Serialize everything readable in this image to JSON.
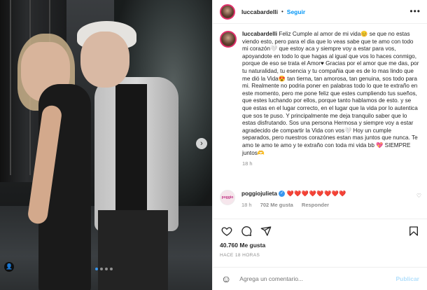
{
  "post": {
    "username": "luccabardelli",
    "separator": "•",
    "follow_label": "Seguir",
    "more_label": "•••",
    "caption_text": "Feliz Cumple al amor de mi vida😊 se que no estas viendo esto, pero para el dia que lo veas sabe que te amo con todo mi corazón🤍 que estoy aca y siempre voy a estar para vos, apoyandote en todo lo que hagas al igual que vos lo haces conmigo, porque de eso se trata el Amor♥ Gracias por el amor que me das, por tu naturalidad, tu esencia y tu compañia que es de lo mas lindo que me dió la Vida😍 tan tierna, tan amorosa, tan genuina, sos todo para mi. Realmente no podria poner en palabras todo lo que te extraño en este momento, pero me pone feliz que estes cumpliendo tus sueños, que estes luchando por ellos, porque tanto hablamos de esto. y se que estas en el lugar correcto, en el lugar que la vida por lo autentica que sos te puso. Y principalmente me deja tranquilo saber que lo estas disfrutando. Sos una persona Hermosa y siempre voy a estar agradecido de compartir la Vida con vos🤍 Hoy un cumple separados, pero nuestros corazónes estan mas juntos que nunca. Te amo te amo te amo y te extraño con toda mi vida bb 💖 SIEMPRE juntos🫶",
    "caption_age": "18 h",
    "likes": "40.760 Me gusta",
    "posted_ago": "HACE 18 HORAS"
  },
  "comment": {
    "avatar_text": "poggio",
    "username": "poggiojulieta",
    "verified_icon": "✓",
    "text": "❤️❤️❤️❤️❤️❤️❤️❤️",
    "age": "18 h",
    "likes": "702 Me gusta",
    "reply_label": "Responder",
    "like_icon": "♡"
  },
  "photo": {
    "next_icon": "›",
    "tag_icon": "👤"
  },
  "add_comment": {
    "placeholder": "Agrega un comentario...",
    "publish_label": "Publicar",
    "emoji_icon": "☺"
  },
  "colors": {
    "accent": "#0095f6",
    "text": "#262626",
    "muted": "#8e8e8e",
    "like": "#ed4956"
  }
}
